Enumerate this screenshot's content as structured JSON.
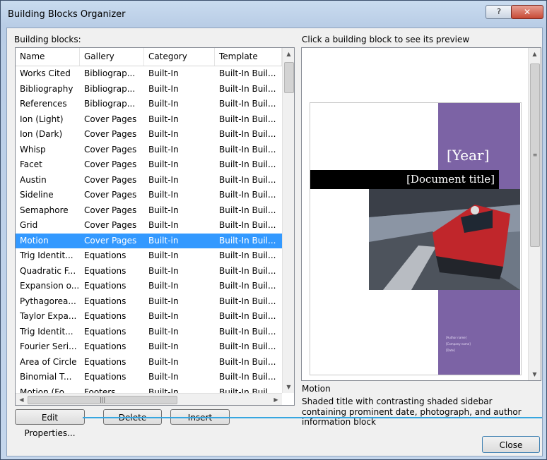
{
  "window": {
    "title": "Building Blocks Organizer",
    "help_label": "?",
    "close_label": "✕"
  },
  "list": {
    "label": "Building blocks:",
    "columns": [
      "Name",
      "Gallery",
      "Category",
      "Template"
    ],
    "rows": [
      [
        "Works Cited",
        "Bibliograp...",
        "Built-In",
        "Built-In Buil..."
      ],
      [
        "Bibliography",
        "Bibliograp...",
        "Built-In",
        "Built-In Buil..."
      ],
      [
        "References",
        "Bibliograp...",
        "Built-In",
        "Built-In Buil..."
      ],
      [
        "Ion (Light)",
        "Cover Pages",
        "Built-In",
        "Built-In Buil..."
      ],
      [
        "Ion (Dark)",
        "Cover Pages",
        "Built-In",
        "Built-In Buil..."
      ],
      [
        "Whisp",
        "Cover Pages",
        "Built-In",
        "Built-In Buil..."
      ],
      [
        "Facet",
        "Cover Pages",
        "Built-In",
        "Built-In Buil..."
      ],
      [
        "Austin",
        "Cover Pages",
        "Built-In",
        "Built-In Buil..."
      ],
      [
        "Sideline",
        "Cover Pages",
        "Built-In",
        "Built-In Buil..."
      ],
      [
        "Semaphore",
        "Cover Pages",
        "Built-In",
        "Built-In Buil..."
      ],
      [
        "Grid",
        "Cover Pages",
        "Built-In",
        "Built-In Buil..."
      ],
      [
        "Motion",
        "Cover Pages",
        "Built-in",
        "Built-In Buil..."
      ],
      [
        "Trig Identit...",
        "Equations",
        "Built-In",
        "Built-In Buil..."
      ],
      [
        "Quadratic F...",
        "Equations",
        "Built-In",
        "Built-In Buil..."
      ],
      [
        "Expansion o...",
        "Equations",
        "Built-In",
        "Built-In Buil..."
      ],
      [
        "Pythagorea...",
        "Equations",
        "Built-In",
        "Built-In Buil..."
      ],
      [
        "Taylor Expa...",
        "Equations",
        "Built-In",
        "Built-In Buil..."
      ],
      [
        "Trig Identit...",
        "Equations",
        "Built-In",
        "Built-In Buil..."
      ],
      [
        "Fourier Seri...",
        "Equations",
        "Built-In",
        "Built-In Buil..."
      ],
      [
        "Area of Circle",
        "Equations",
        "Built-In",
        "Built-In Buil..."
      ],
      [
        "Binomial T...",
        "Equations",
        "Built-In",
        "Built-In Buil..."
      ],
      [
        "Motion (Fo...",
        "Footers",
        "Built-In",
        "Built-In Buil..."
      ]
    ],
    "selected_index": 11
  },
  "buttons": {
    "edit_properties": "Edit Properties...",
    "delete": "Delete",
    "insert": "Insert",
    "close": "Close"
  },
  "preview": {
    "label": "Click a building block to see its preview",
    "year_placeholder": "[Year]",
    "title_placeholder": "[Document title]",
    "small_lines": [
      "[Author name]",
      "[Company name]",
      "[Date]"
    ],
    "selected_name": "Motion",
    "description": "Shaded title with contrasting shaded sidebar containing prominent date, photograph, and author information block"
  },
  "colors": {
    "selection": "#3399ff",
    "sidebar_purple": "#7c63a5",
    "accent_line": "#36a6e0"
  }
}
